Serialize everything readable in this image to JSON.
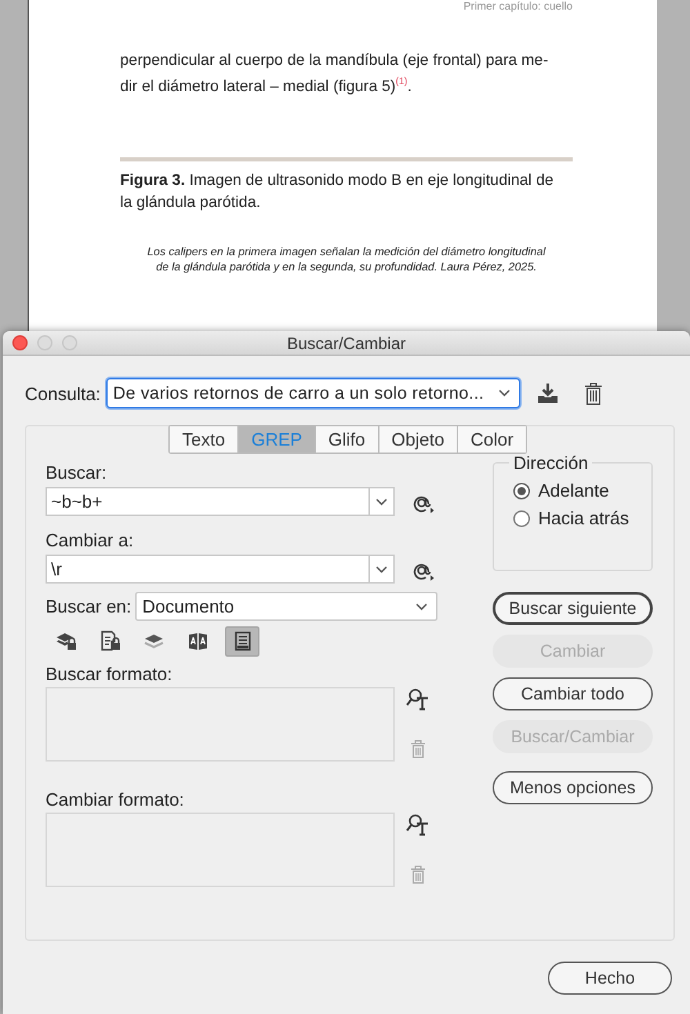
{
  "document": {
    "running_header": "Primer capítulo: cuello",
    "paragraph_lines": [
      "perpendicular al cuerpo de la mandíbula (eje frontal) para me-",
      "dir el diámetro lateral – medial (figura 5)$^{(1)}$."
    ],
    "caption_lines": [
      "**Figura 3.** Imagen de ultrasonido modo B en eje longitudinal de",
      "la glándula parótida."
    ],
    "note_lines": [
      "Los calipers en la primera imagen señalan la medición del diámetro longitudinal",
      "de la glándula parótida y en la segunda, su profundidad. Laura Pérez, 2025."
    ]
  },
  "dialog": {
    "title": "Buscar/Cambiar",
    "query_label": "Consulta:",
    "query_value": "De varios retornos de carro a un solo retorno...",
    "tabs": [
      {
        "label": "Texto",
        "selected": false
      },
      {
        "label": "GREP",
        "selected": true
      },
      {
        "label": "Glifo",
        "selected": false
      },
      {
        "label": "Objeto",
        "selected": false
      },
      {
        "label": "Color",
        "selected": false
      }
    ],
    "find_label": "Buscar:",
    "find_value": "~b~b+",
    "change_label": "Cambiar a:",
    "change_value": "\\r",
    "search_in_label": "Buscar en:",
    "search_in_value": "Documento",
    "options": [
      {
        "kind": "locked-layers",
        "on": false
      },
      {
        "kind": "locked-stories",
        "on": false
      },
      {
        "kind": "hidden-layers",
        "on": false
      },
      {
        "kind": "master-pages",
        "on": false
      },
      {
        "kind": "footnotes",
        "on": true
      }
    ],
    "find_format_label": "Buscar formato:",
    "change_format_label": "Cambiar formato:",
    "direction": {
      "title": "Dirección",
      "options": [
        {
          "label": "Adelante",
          "selected": true
        },
        {
          "label": "Hacia atrás",
          "selected": false
        }
      ]
    },
    "buttons": [
      {
        "label": "Buscar siguiente",
        "default": true,
        "disabled": false
      },
      {
        "label": "Cambiar",
        "default": false,
        "disabled": true
      },
      {
        "label": "Cambiar todo",
        "default": false,
        "disabled": false
      },
      {
        "label": "Buscar/Cambiar",
        "default": false,
        "disabled": true
      },
      {
        "label": "Menos opciones",
        "default": false,
        "disabled": false
      }
    ],
    "done_button": "Hecho"
  }
}
